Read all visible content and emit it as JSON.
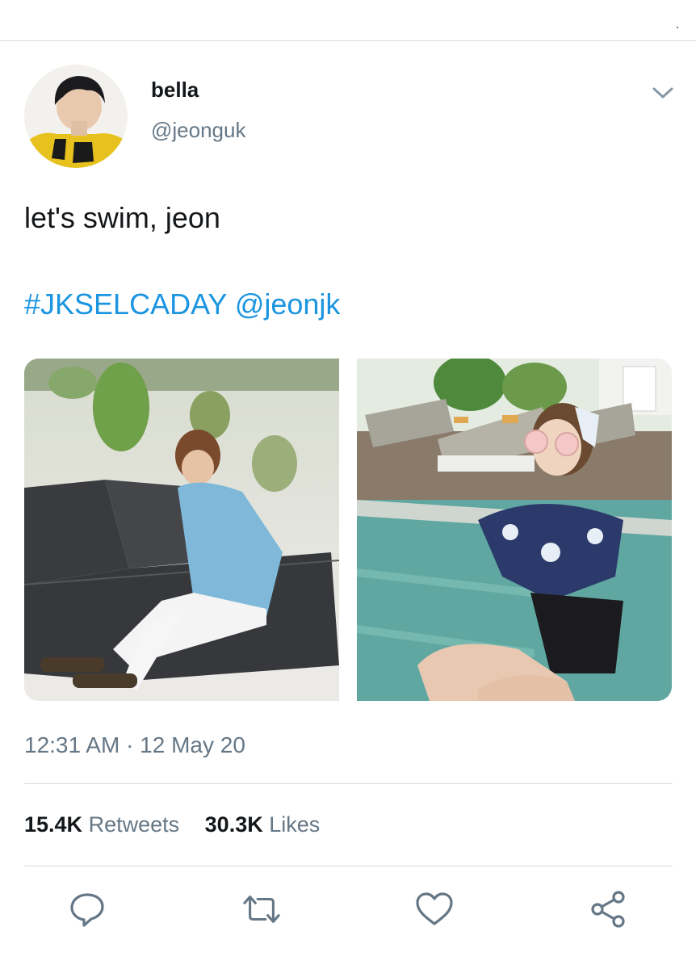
{
  "tweet": {
    "display_name": "bella",
    "handle": "@jeonguk",
    "text": "let's swim, jeon",
    "hashtag": "#JKSELCADAY",
    "mention": "@jeonjk",
    "timestamp": "12:31 AM · 12 May 20"
  },
  "stats": {
    "retweets_count": "15.4K",
    "retweets_label": "Retweets",
    "likes_count": "30.3K",
    "likes_label": "Likes"
  },
  "media": [
    {
      "label": "photo-man-on-lounger"
    },
    {
      "label": "photo-woman-by-pool"
    }
  ],
  "icons": {
    "more": "chevron-down-icon",
    "reply": "reply-icon",
    "retweet": "retweet-icon",
    "like": "heart-icon",
    "share": "share-icon"
  },
  "colors": {
    "link": "#1b95e0",
    "secondary_text": "#657786",
    "divider": "#d6dde3",
    "icon": "#657786"
  }
}
